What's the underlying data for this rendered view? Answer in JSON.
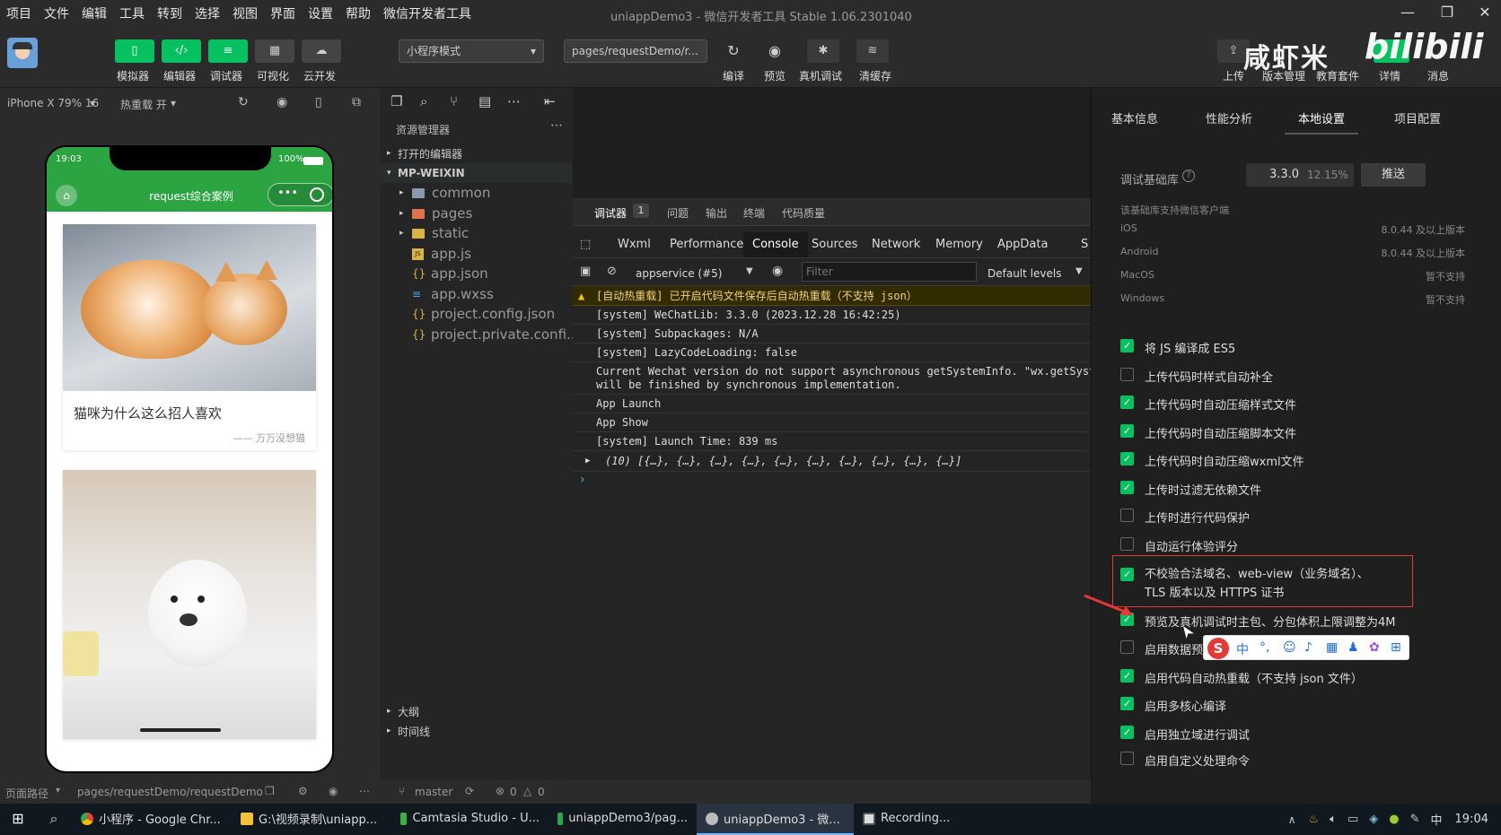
{
  "menubar": {
    "items": [
      "项目",
      "文件",
      "编辑",
      "工具",
      "转到",
      "选择",
      "视图",
      "界面",
      "设置",
      "帮助",
      "微信开发者工具"
    ],
    "title": "uniappDemo3 - 微信开发者工具 Stable 1.06.2301040"
  },
  "toolbar": {
    "buttons": [
      {
        "label": "模拟器",
        "icon": "phone-icon"
      },
      {
        "label": "编辑器",
        "icon": "code-icon"
      },
      {
        "label": "调试器",
        "icon": "debug-icon"
      },
      {
        "label": "可视化",
        "icon": "grid-icon"
      },
      {
        "label": "云开发",
        "icon": "cloud-icon"
      }
    ],
    "mode": "小程序模式",
    "page_path": "pages/requestDemo/r...",
    "actions": [
      "编译",
      "预览",
      "真机调试",
      "清缓存"
    ],
    "right_actions": [
      "上传",
      "版本管理",
      "教育套件",
      "详情",
      "消息"
    ]
  },
  "watermark": {
    "text1": "咸虾米",
    "text2": "bilibili"
  },
  "simulator": {
    "device": "iPhone X 79% 16",
    "hot_reload": "热重载 开",
    "time": "19:03",
    "battery": "100%",
    "page_title": "request综合案例",
    "cards": [
      {
        "title": "猫咪为什么这么招人喜欢",
        "author": "—— 万万没想猫"
      }
    ]
  },
  "explorer": {
    "header": "资源管理器",
    "open_editors": "打开的编辑器",
    "root": "MP-WEIXIN",
    "folders": [
      "common",
      "pages",
      "static"
    ],
    "files": [
      "app.js",
      "app.json",
      "app.wxss",
      "project.config.json",
      "project.private.confi..."
    ],
    "outline": "大纲",
    "timeline": "时间线"
  },
  "devtools": {
    "top_tabs": [
      "调试器",
      "问题",
      "输出",
      "终端",
      "代码质量"
    ],
    "badge": "1",
    "tabs": [
      "Wxml",
      "Performance",
      "Console",
      "Sources",
      "Network",
      "Memory",
      "AppData",
      "S"
    ],
    "context": "appservice (#5)",
    "filter_placeholder": "Filter",
    "levels": "Default levels",
    "lines": [
      "[自动热重载] 已开启代码文件保存后自动热重载（不支持 json）",
      "[system] WeChatLib: 3.3.0 (2023.12.28 16:42:25)",
      "[system] Subpackages: N/A",
      "[system] LazyCodeLoading: false",
      "Current Wechat version do not support asynchronous getSystemInfo. \"wx.getSyste\nwill be finished by synchronous implementation.",
      "App Launch",
      "App Show",
      "[system] Launch Time: 839 ms",
      "(10) [{…}, {…}, {…}, {…}, {…}, {…}, {…}, {…}, {…}, {…}]"
    ],
    "prompt": "›"
  },
  "right_panel": {
    "tabs": [
      "基本信息",
      "性能分析",
      "本地设置",
      "项目配置"
    ],
    "lib_label": "调试基础库",
    "lib_version": "3.3.0",
    "lib_percent": "12.15%",
    "push": "推送",
    "support_note": "该基础库支持微信客户端",
    "platforms": [
      {
        "name": "iOS",
        "value": "8.0.44 及以上版本"
      },
      {
        "name": "Android",
        "value": "8.0.44 及以上版本"
      },
      {
        "name": "MacOS",
        "value": "暂不支持"
      },
      {
        "name": "Windows",
        "value": "暂不支持"
      }
    ],
    "options": [
      {
        "label": "将 JS 编译成 ES5",
        "checked": true
      },
      {
        "label": "上传代码时样式自动补全",
        "checked": false
      },
      {
        "label": "上传代码时自动压缩样式文件",
        "checked": true
      },
      {
        "label": "上传代码时自动压缩脚本文件",
        "checked": true
      },
      {
        "label": "上传代码时自动压缩wxml文件",
        "checked": true
      },
      {
        "label": "上传时过滤无依赖文件",
        "checked": true
      },
      {
        "label": "上传时进行代码保护",
        "checked": false
      },
      {
        "label": "自动运行体验评分",
        "checked": false
      },
      {
        "label": "不校验合法域名、web-view（业务域名）、TLS 版本以及 HTTPS 证书",
        "checked": true
      },
      {
        "label": "预览及真机调试时主包、分包体积上限调整为4M",
        "checked": true
      },
      {
        "label": "启用数据预",
        "checked": false
      },
      {
        "label": "启用代码自动热重载（不支持 json 文件）",
        "checked": true
      },
      {
        "label": "启用多核心编译",
        "checked": true
      },
      {
        "label": "启用独立域进行调试",
        "checked": true
      },
      {
        "label": "启用自定义处理命令",
        "checked": false
      }
    ],
    "ime": "中"
  },
  "statusbar": {
    "page_path_label": "页面路径",
    "page_path": "pages/requestDemo/requestDemo",
    "branch": "master",
    "errors": "0",
    "warnings": "0"
  },
  "taskbar": {
    "tasks": [
      "小程序 - Google Chr...",
      "G:\\视频录制\\uniapp...",
      "Camtasia Studio - U...",
      "uniappDemo3/pag...",
      "uniappDemo3 - 微...",
      "Recording..."
    ],
    "ime": "中",
    "time": "19:04"
  },
  "colors": {
    "accent": "#07c160",
    "nav_green": "#2ca442",
    "highlight": "#e53935"
  }
}
